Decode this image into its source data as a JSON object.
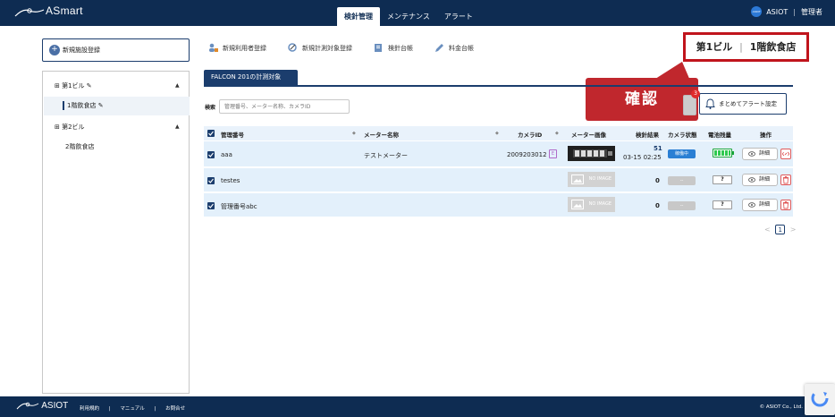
{
  "header": {
    "logo": "ASmart",
    "nav": [
      "検針管理",
      "メンテナンス",
      "アラート"
    ],
    "user_icon_text": "ASIOT",
    "org": "ASIOT",
    "role": "管理者"
  },
  "sidebar": {
    "new_facility_button": "新規施設登録",
    "tree": [
      {
        "label": "第1ビル",
        "children": [
          "1階飲食店"
        ]
      },
      {
        "label": "第2ビル",
        "children": [
          "2階飲食店"
        ]
      }
    ]
  },
  "toolbar": {
    "items": [
      "新規利用者登録",
      "新規計測対象登録",
      "検針台帳",
      "料金台帳"
    ]
  },
  "page_title": {
    "building": "第1ビル",
    "separator": "|",
    "floor": "1階飲食店"
  },
  "callout": "確認",
  "tab": "FALCON 201の計測対象",
  "search": {
    "label": "検索",
    "placeholder": "管理番号、メーター名称、カメラID"
  },
  "alert_button": "まとめてアラート設定",
  "alert_badge": "3",
  "table": {
    "headers": [
      "管理番号",
      "メーター名称",
      "カメラID",
      "メーター画像",
      "検針結果",
      "カメラ状態",
      "電池残量",
      "操作"
    ],
    "rows": [
      {
        "id": "aaa",
        "name": "テストメーター",
        "camera_id": "2009203012",
        "camera_tag": "E",
        "result": "51",
        "result_time": "03-15 02:25",
        "status": "稼働中",
        "battery": "full",
        "detail": "詳細"
      },
      {
        "id": "testes",
        "name": "",
        "camera_id": "",
        "camera_tag": "",
        "result": "0",
        "result_time": "",
        "status": "--",
        "battery": "?",
        "detail": "詳細",
        "noimage": "NO IMAGE"
      },
      {
        "id": "管理番号abc",
        "name": "",
        "camera_id": "",
        "camera_tag": "",
        "result": "0",
        "result_time": "",
        "status": "--",
        "battery": "?",
        "detail": "詳細",
        "noimage": "NO IMAGE"
      }
    ]
  },
  "pager": {
    "current": "1",
    "prev": "<",
    "next": ">"
  },
  "footer": {
    "logo": "ASIOT",
    "links": [
      "利用規約",
      "|",
      "マニュアル",
      "|",
      "お問合せ"
    ],
    "copyright": "© ASIOT Co., Ltd."
  },
  "colors": {
    "navy": "#0e2c52",
    "accent_red": "#c0141c",
    "row_bg": "#e3f0fb",
    "status_blue": "#2a7fd4"
  }
}
